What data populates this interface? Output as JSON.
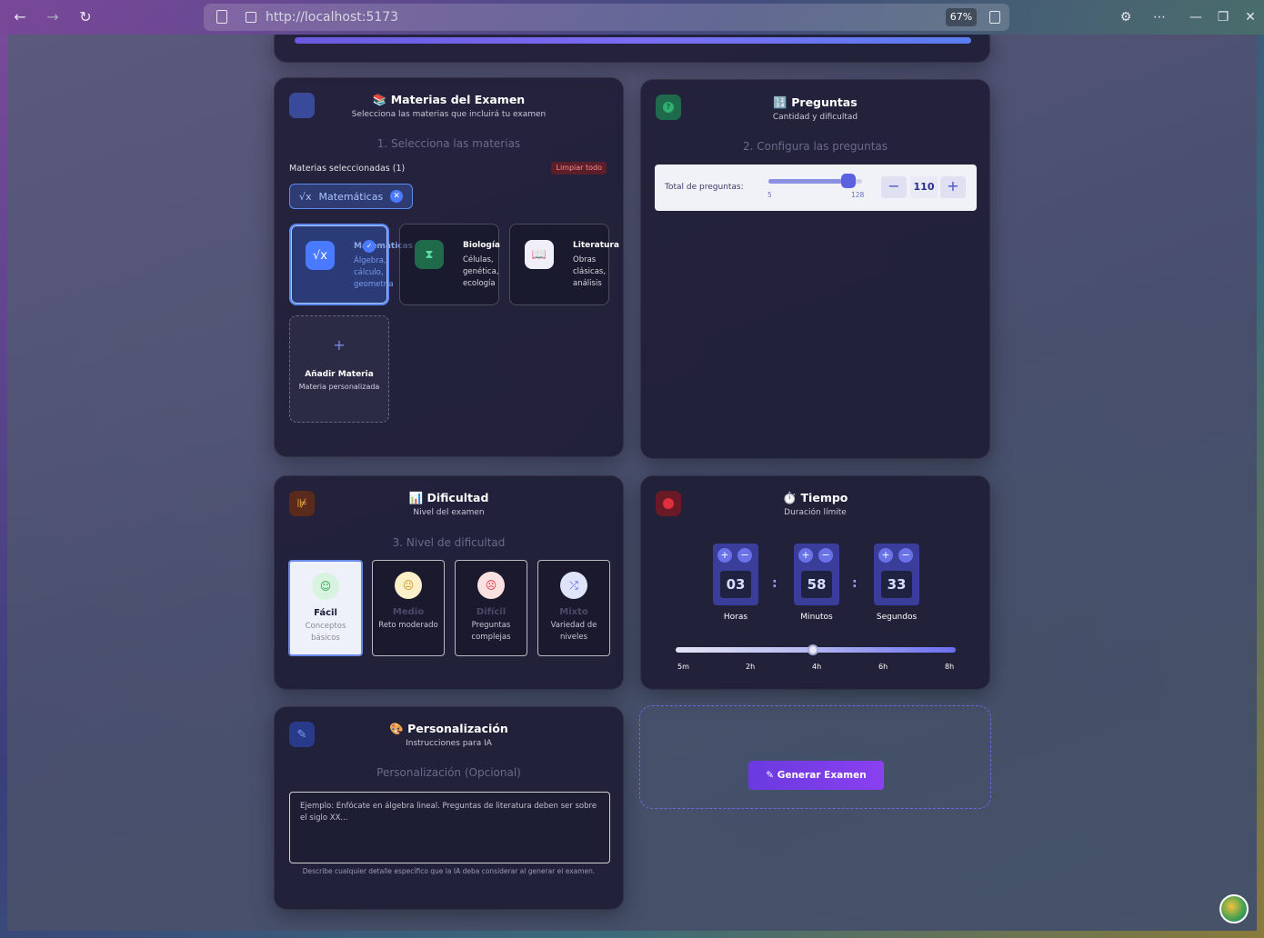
{
  "browser": {
    "url": "http://localhost:5173",
    "zoom": "67%"
  },
  "progress": 1.0,
  "subjects_card": {
    "title": "📚 Materias del Examen",
    "subtitle": "Selecciona las materias que incluirá tu examen",
    "step": "1. Selecciona las materias",
    "selected_label": "Materias seleccionadas (1)",
    "clear_label": "Limpiar todo",
    "chip": {
      "icon": "√x",
      "label": "Matemáticas"
    },
    "items": [
      {
        "name": "Matemáticas",
        "icon": "√x",
        "desc": "Álgebra, cálculo, geometría",
        "selected": true,
        "color": "#4a7aff"
      },
      {
        "name": "Biología",
        "icon": "⧗",
        "desc": "Células, genética, ecología",
        "selected": false,
        "color": "#1f6a4a"
      },
      {
        "name": "Literatura",
        "icon": "📖",
        "desc": "Obras clásicas, análisis",
        "selected": false,
        "color": "#f0eef8"
      }
    ],
    "add": {
      "plus": "+",
      "title": "Añadir Materia",
      "desc": "Materia personalizada"
    }
  },
  "questions_card": {
    "icon": "?",
    "title": "🔢 Preguntas",
    "subtitle": "Cantidad y dificultad",
    "step": "2. Configura las preguntas",
    "total_label": "Total de preguntas:",
    "min": "5",
    "max": "128",
    "value": "110",
    "minus": "−",
    "plus": "+"
  },
  "difficulty_card": {
    "title": "📊 Dificultad",
    "subtitle": "Nivel del examen",
    "step": "3. Nivel de dificultad",
    "levels": [
      {
        "name": "Fácil",
        "desc": "Conceptos básicos",
        "icon": "☺",
        "selected": true
      },
      {
        "name": "Medio",
        "desc": "Reto moderado",
        "icon": "😐",
        "selected": false
      },
      {
        "name": "Difícil",
        "desc": "Preguntas complejas",
        "icon": "☹",
        "selected": false
      },
      {
        "name": "Mixto",
        "desc": "Variedad de niveles",
        "icon": "⤮",
        "selected": false
      }
    ]
  },
  "time_card": {
    "title": "⏱️ Tiempo",
    "subtitle": "Duración límite",
    "hours": {
      "value": "03",
      "label": "Horas"
    },
    "minutes": {
      "value": "58",
      "label": "Minutos"
    },
    "seconds": {
      "value": "33",
      "label": "Segundos"
    },
    "slider_fraction": 0.49,
    "ticks": [
      "5m",
      "2h",
      "4h",
      "6h",
      "8h"
    ]
  },
  "personalization_card": {
    "title": "🎨 Personalización",
    "subtitle": "Instrucciones para IA",
    "step": "Personalización (Opcional)",
    "placeholder": "Ejemplo: Enfócate en álgebra lineal. Preguntas de literatura deben ser sobre el siglo XX...",
    "hint": "Describe cualquier detalle específico que la IA deba considerar al generar el examen."
  },
  "generate_button": "✎ Generar Examen"
}
